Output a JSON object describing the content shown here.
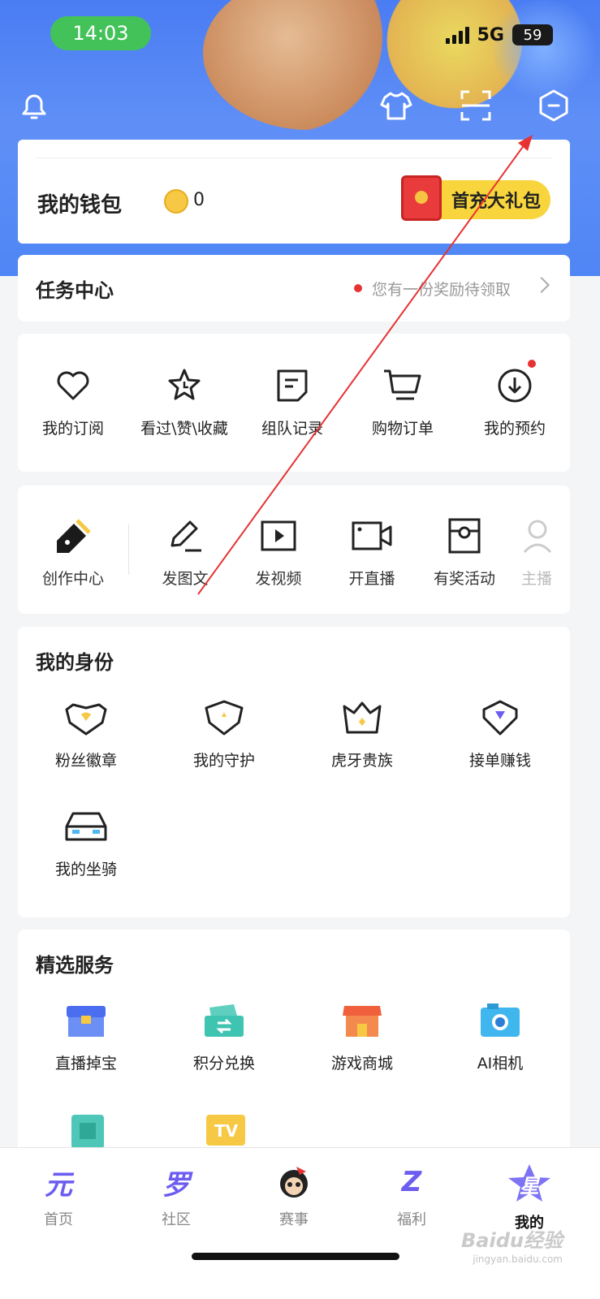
{
  "status": {
    "time": "14:03",
    "network": "5G",
    "battery": "59"
  },
  "header": {
    "icons": [
      "bell-icon",
      "tshirt-icon",
      "scan-icon",
      "settings-hex-icon"
    ]
  },
  "wallet": {
    "title": "我的钱包",
    "coins": "0",
    "gift_label": "首充大礼包"
  },
  "task": {
    "title": "任务中心",
    "hint": "您有一份奖励待领取"
  },
  "quick": [
    {
      "label": "我的订阅",
      "icon": "heart-icon"
    },
    {
      "label": "看过\\赞\\收藏",
      "icon": "star-clock-icon"
    },
    {
      "label": "组队记录",
      "icon": "note-icon"
    },
    {
      "label": "购物订单",
      "icon": "cart-icon"
    },
    {
      "label": "我的预约",
      "icon": "download-icon"
    }
  ],
  "create": [
    {
      "label": "创作中心",
      "icon": "pen-nib-icon"
    },
    {
      "label": "发图文",
      "icon": "edit-icon"
    },
    {
      "label": "发视频",
      "icon": "play-icon"
    },
    {
      "label": "开直播",
      "icon": "camera-icon"
    },
    {
      "label": "有奖活动",
      "icon": "prize-icon"
    },
    {
      "label": "主播",
      "icon": "person-icon"
    }
  ],
  "identity": {
    "title": "我的身份",
    "items": [
      {
        "label": "粉丝徽章",
        "icon": "fan-badge-icon"
      },
      {
        "label": "我的守护",
        "icon": "shield-icon"
      },
      {
        "label": "虎牙贵族",
        "icon": "crown-icon"
      },
      {
        "label": "接单赚钱",
        "icon": "gem-badge-icon"
      },
      {
        "label": "我的坐骑",
        "icon": "car-icon"
      }
    ]
  },
  "services": {
    "title": "精选服务",
    "items": [
      {
        "label": "直播掉宝",
        "icon": "treasure-chest-icon"
      },
      {
        "label": "积分兑换",
        "icon": "exchange-icon"
      },
      {
        "label": "游戏商城",
        "icon": "store-icon"
      },
      {
        "label": "AI相机",
        "icon": "ai-camera-icon"
      }
    ],
    "extra_icons": [
      "calendar-icon",
      "tv-icon"
    ]
  },
  "tabs": [
    {
      "label": "首页",
      "glyph": "元"
    },
    {
      "label": "社区",
      "glyph": "罗"
    },
    {
      "label": "赛事",
      "glyph": ""
    },
    {
      "label": "福利",
      "glyph": "Z"
    },
    {
      "label": "我的",
      "glyph": "星"
    }
  ],
  "watermark": {
    "main": "Baidu经验",
    "sub": "jingyan.baidu.com"
  },
  "colors": {
    "brand_blue": "#4f86f5",
    "accent_purple": "#6c5cf0",
    "gift_yellow": "#f8d53c",
    "alert_red": "#e63232"
  }
}
